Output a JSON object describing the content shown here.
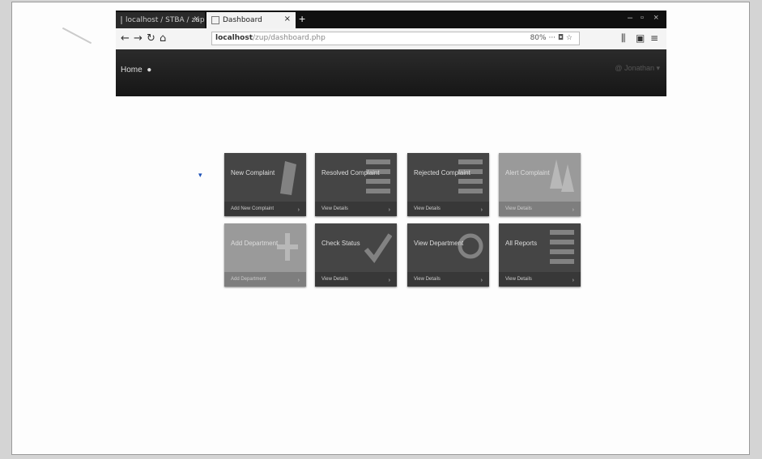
{
  "browser": {
    "tabs": [
      {
        "label": "localhost / STBA / zup.ph",
        "active": false
      },
      {
        "label": "Dashboard",
        "active": true
      }
    ],
    "new_tab": "+",
    "url_host": "localhost",
    "url_path": "/zup/dashboard.php",
    "zoom": "80%"
  },
  "app": {
    "home_label": "Home",
    "user_label": "@ Jonathan ▾"
  },
  "tiles": [
    {
      "title": "New Complaint",
      "footer": "Add New Complaint",
      "style": "dark",
      "icon": "pen-icon"
    },
    {
      "title": "Resolved Complaint",
      "footer": "View Details",
      "style": "dark",
      "icon": "list-icon"
    },
    {
      "title": "Rejected Complaint",
      "footer": "View Details",
      "style": "dark",
      "icon": "list-icon"
    },
    {
      "title": "Alert Complaint",
      "footer": "View Details",
      "style": "light",
      "icon": "tree-icon"
    },
    {
      "title": "Add Department",
      "footer": "Add Department",
      "style": "light",
      "icon": "plus-icon"
    },
    {
      "title": "Check Status",
      "footer": "View Details",
      "style": "dark",
      "icon": "check-icon"
    },
    {
      "title": "View Department",
      "footer": "View Details",
      "style": "dark",
      "icon": "badge-icon"
    },
    {
      "title": "All Reports",
      "footer": "View Details",
      "style": "dark",
      "icon": "list-icon"
    }
  ]
}
